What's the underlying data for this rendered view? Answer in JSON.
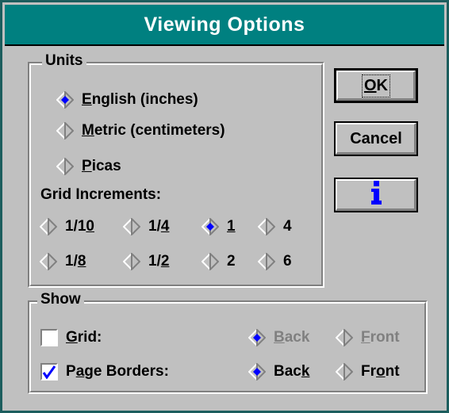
{
  "dialog": {
    "title": "Viewing Options"
  },
  "units": {
    "legend": "Units",
    "options": [
      {
        "pre": "",
        "u": "E",
        "post": "nglish (inches)",
        "selected": true
      },
      {
        "pre": "",
        "u": "M",
        "post": "etric (centimeters)",
        "selected": false
      },
      {
        "pre": "",
        "u": "P",
        "post": "icas",
        "selected": false
      }
    ],
    "grid_label": "Grid Increments:",
    "grid": [
      {
        "pre": "1/1",
        "u": "0",
        "post": "",
        "selected": false
      },
      {
        "pre": "1/",
        "u": "4",
        "post": "",
        "selected": false
      },
      {
        "pre": "",
        "u": "1",
        "post": "",
        "selected": true
      },
      {
        "pre": "4",
        "u": "",
        "post": "",
        "selected": false
      },
      {
        "pre": "1/",
        "u": "8",
        "post": "",
        "selected": false
      },
      {
        "pre": "1/",
        "u": "2",
        "post": "",
        "selected": false
      },
      {
        "pre": "2",
        "u": "",
        "post": "",
        "selected": false
      },
      {
        "pre": "6",
        "u": "",
        "post": "",
        "selected": false
      }
    ]
  },
  "buttons": {
    "ok": {
      "pre": "",
      "u": "O",
      "post": "K"
    },
    "cancel": "Cancel",
    "info_icon": "info-icon"
  },
  "show": {
    "legend": "Show",
    "grid": {
      "pre": "",
      "u": "G",
      "post": "rid:",
      "checked": false,
      "back": {
        "pre": "",
        "u": "B",
        "post": "ack",
        "selected": true
      },
      "front": {
        "pre": "",
        "u": "F",
        "post": "ront",
        "selected": false
      },
      "enabled": false
    },
    "borders": {
      "pre": "P",
      "u": "a",
      "post": "ge Borders:",
      "checked": true,
      "back": {
        "pre": "Bac",
        "u": "k",
        "post": "",
        "selected": true
      },
      "front": {
        "pre": "Fr",
        "u": "o",
        "post": "nt",
        "selected": false
      },
      "enabled": true
    }
  },
  "colors": {
    "titlebar": "#008080",
    "face": "#c0c0c0",
    "accent": "#0000ff"
  }
}
